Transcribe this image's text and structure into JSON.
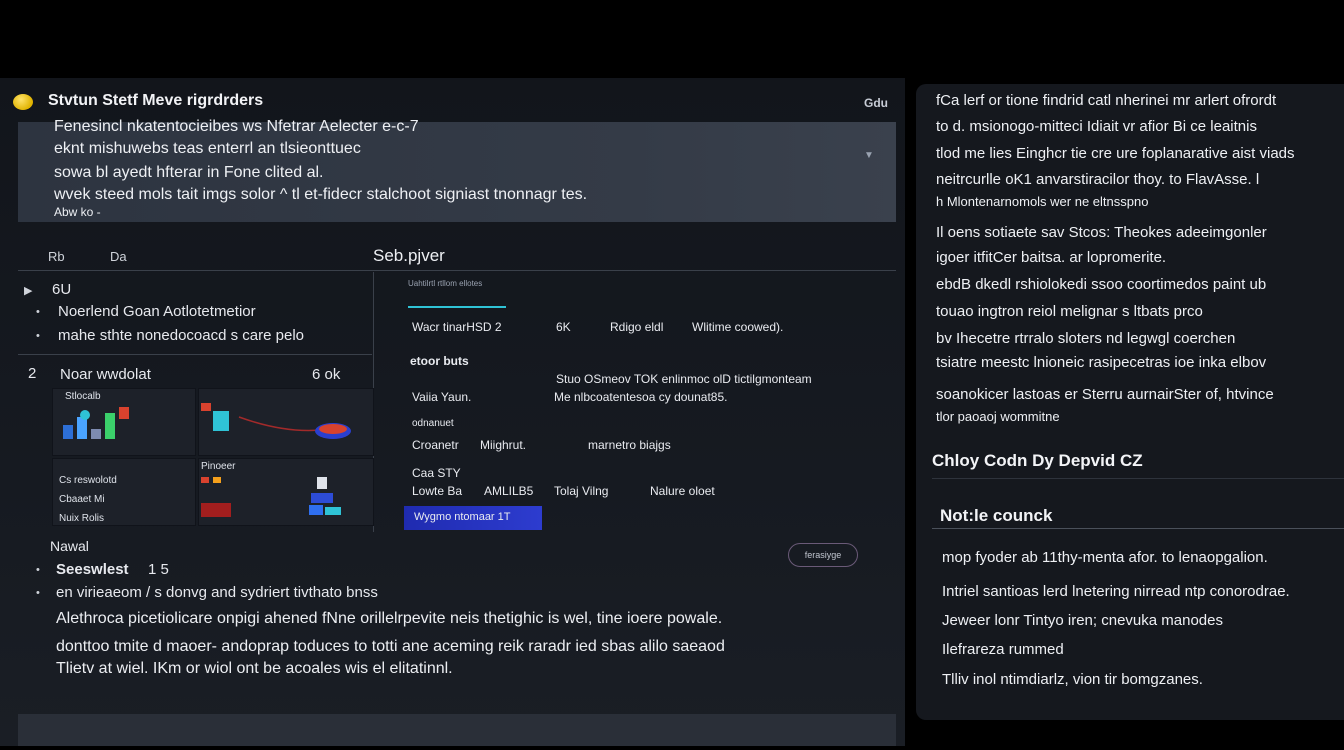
{
  "header": {
    "title": "Stvtun Stetf Meve rigrdrders",
    "badge": "Gdu"
  },
  "banner": {
    "lines": [
      "Fenesincl nkatentocieibes ws Nfetrar Aelecter e-c-7",
      "eknt mishuwebs teas enterrl an tlsieonttuec",
      "sowa bl ayedt hfterar in Fone clited al.",
      "wvek steed mols tait imgs solor ^ tl et-fidecr stalchoot signiast tnonnagr tes.",
      "Abw ko -"
    ]
  },
  "columns": {
    "c1": "Rb",
    "c2": "Da",
    "section_title": "Seb.pjver"
  },
  "list": {
    "item1": "6U",
    "item2": "Noerlend Goan Aotlotetmetior",
    "item3": "mahe sthte nonedocoacd s care pelo"
  },
  "grid_header": {
    "number": "2",
    "label": "Noar wwdolat",
    "right": "6 ok"
  },
  "grid": {
    "c1": "Stlocalb",
    "c3": "Cs reswolotd\nCbaaet Mi\nNuix Rolis",
    "c4": "Pinoeer"
  },
  "mid": {
    "tab_label": "Uahtilrtl rtllom ellotes",
    "r1_c1": "Wacr tinarHSD 2",
    "r1_c2": "6K",
    "r1_c3": "Rdigo eldl",
    "r1_c4": "Wlitime coowed).",
    "h2": "etoor buts",
    "r2_desc": "Stuo OSmeov TOK enlinmoc olD tictilgmonteam",
    "r3_c1": "Vaiia Yaun.",
    "r3_c2": "Me nlbcoatentesoa cy dounat85.",
    "h3": "odnanuet",
    "r4_c1": "Croanetr",
    "r4_c2": "Miighrut.",
    "r4_c3": "marnetro biajgs",
    "h4": "Caa STY",
    "r5_c1": "Lowte Ba",
    "r5_c2": "AMLILB5",
    "r5_c3": "Tolaj Vilng",
    "r5_c4": "Nalure oloet",
    "footer_bar": "Wygmo ntomaar 1T"
  },
  "section2": {
    "label": "Nawal",
    "title": "Seeswlest",
    "count": "1 5",
    "pill": "ferasiyge",
    "line1": "en virieaeom / s donvg and sydriert tivthato bnss",
    "p1": "Alethroca picetiolicare onpigi ahened fNne orillelrpevite neis thetighic is wel, tine ioere powale.",
    "p2": "donttoo tmite d  maoer- andoprap toduces  to totti ane aceming reik raradr ied sbas alilo saeaod",
    "p3": "Tlietv at wiel.  IKm or wiol ont be acoales wis el elitatinnl."
  },
  "right": {
    "p1": [
      "fCa  lerf or tione findrid catl nherinei mr arlert ofrordt",
      "to d. msionogo-mitteci Idiait vr afior Bi ce leaitnis",
      "tlod me lies Einghcr tie cre ure foplanarative aist viads",
      "neitrcurlle oK1 anvarstiracilor thoy. to FlavAsse. l",
      "h Mlontenarnomols wer ne eltnsspno"
    ],
    "p2": [
      "Il oens sotiaete sav Stcos:  Theokes adeeimgonler",
      "igoer itfitCer baitsa. ar lopromerite.",
      "ebdB dkedl rshiolokedi ssoo coortimedos paint ub",
      "touao ingtron reiol melignar s ltbats prco",
      "bv Ihecetre rtrralo sloters nd legwgl coerchen",
      "tsiatre meestc lnioneic rasipecetras ioe inka elbov"
    ],
    "p3": [
      "soanokicer lastoas er Sterru aurnairSter of, htvince",
      "tlor paoaoj wommitne"
    ],
    "heading1": "Chloy Codn Dy Depvid CZ",
    "heading2": "Not:le counck",
    "list": [
      "mop fyoder ab 11thy-menta afor. to lenaopgalion.",
      "Intriel santioas lerd lnetering nirread ntp conorodrae.",
      "Jeweer lonr Tintyo iren; cnevuka manodes",
      "Ilefrareza rummed",
      "Tlliv inol ntimdiarlz, vion tir bomgzanes."
    ]
  },
  "colors": {
    "accent_cyan": "#2fc3d6",
    "accent_blue": "#2d3ccf",
    "logo_yellow": "#f4cc1c"
  }
}
